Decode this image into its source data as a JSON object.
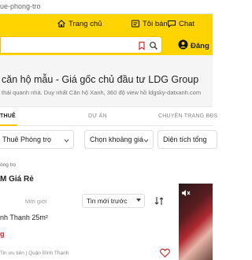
{
  "browser": {
    "url": "ue-phong-tro"
  },
  "topnav": {
    "home_label": "Trang chủ",
    "my_label": "Tôi bán",
    "chat_label": "Chat"
  },
  "header": {
    "login_label": "Đăng"
  },
  "banner": {
    "title": "căn hộ mẫu - Giá gốc chủ đầu tư LDG Group",
    "subtitle": "thái quanh nhà. Duy nhất Căn hộ Xanh, 360 độ view hồ ldgsky-datxanh.com"
  },
  "tabs": [
    {
      "label": "THUÊ",
      "active": true
    },
    {
      "label": "DỰ ÁN",
      "active": false
    },
    {
      "label": "CHUYÊN TRANG BĐS",
      "active": false
    }
  ],
  "filters": {
    "type": "Thuê Phòng trọ",
    "price": "Chọn khoảng giá",
    "area": "Diện tích tổng"
  },
  "breadcrumb": "òng trọ",
  "section": {
    "title": "M Giá Rẻ"
  },
  "sort": {
    "label": "Mới giới",
    "selected": "Tin mới trước"
  },
  "listing": {
    "title": "nh Thạnh 25m²",
    "price": "g",
    "meta": "Tin ưu tiên  |  Quận Bình Thạnh"
  },
  "colors": {
    "brand_yellow": "#ffd400",
    "price_red": "#e0192a",
    "icon_red": "#d32f2f"
  },
  "icons": [
    "home-icon",
    "mine-icon",
    "chat-icon",
    "bookmark-icon",
    "search-icon",
    "user-icon",
    "chevron-down-icon",
    "sort-icon",
    "heart-icon",
    "mute-icon"
  ]
}
